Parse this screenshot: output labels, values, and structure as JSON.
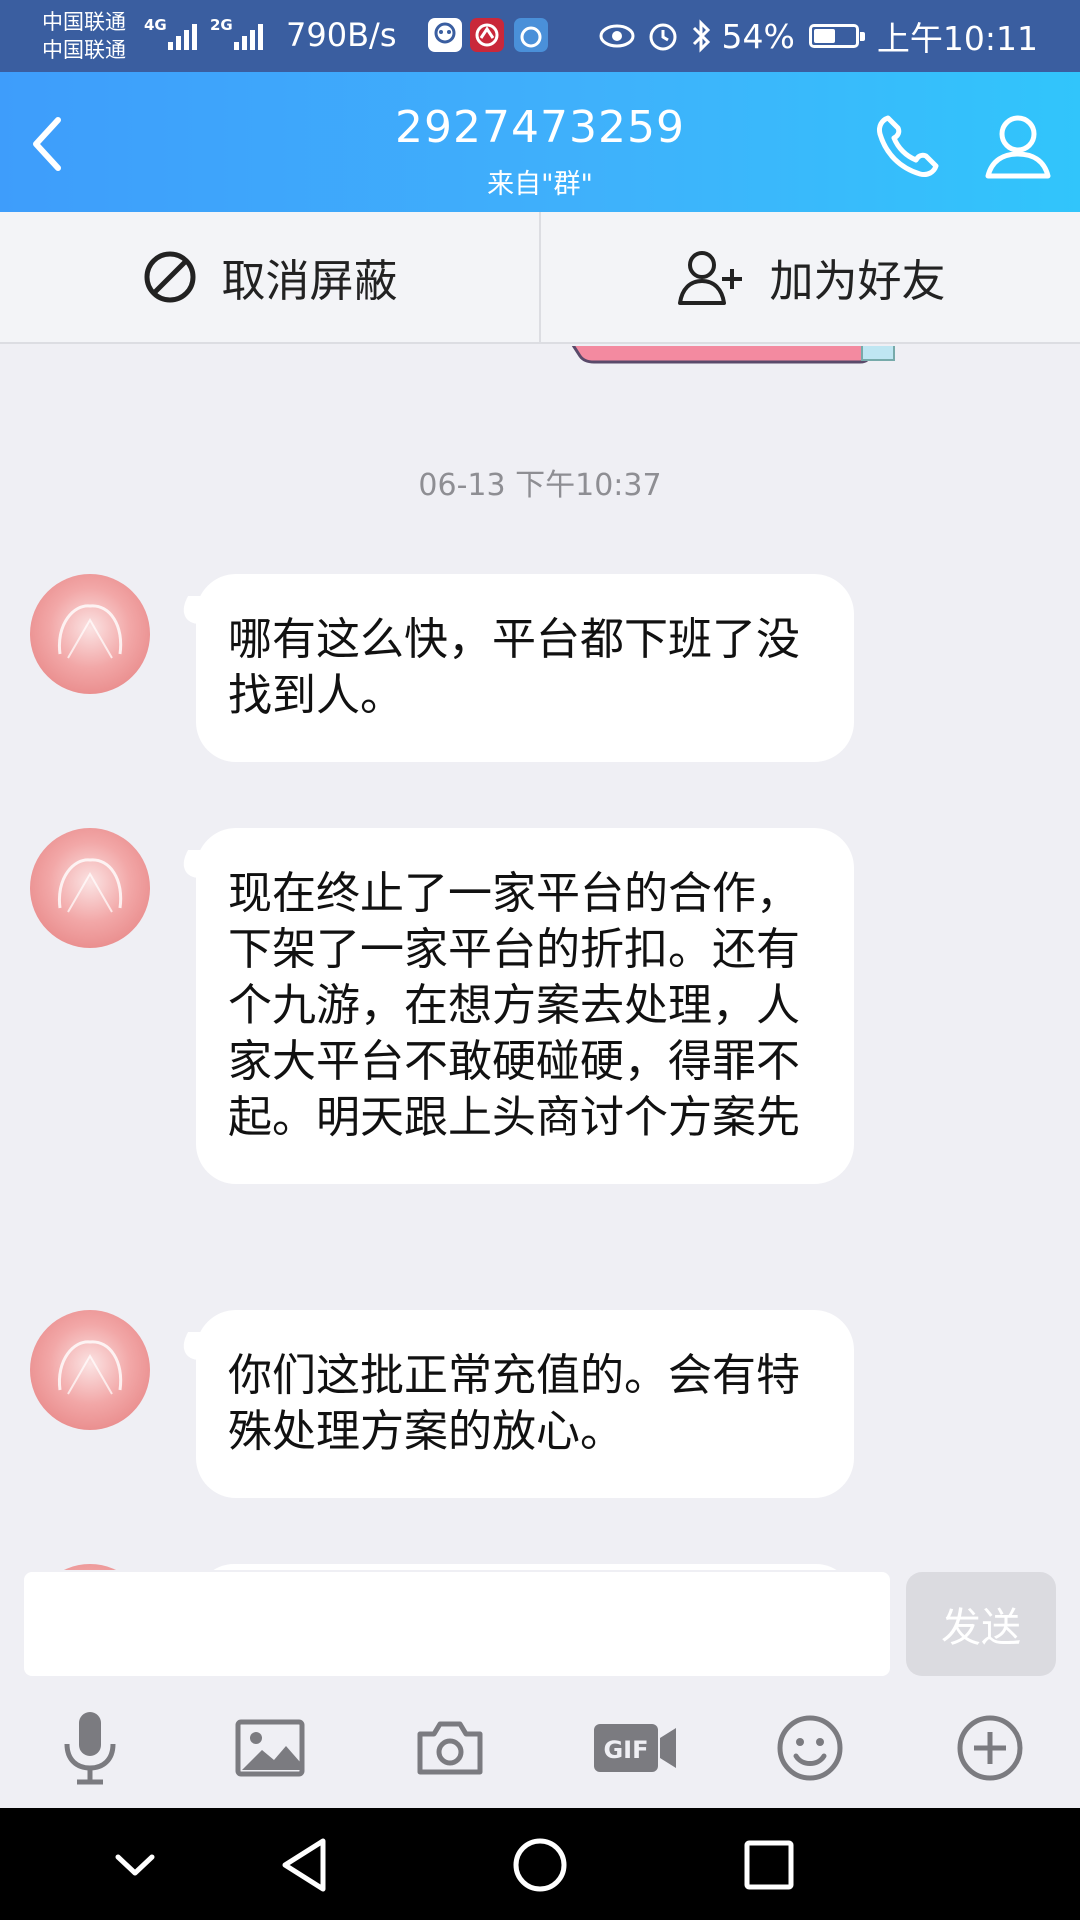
{
  "status_bar": {
    "carrier_1": "中国联通",
    "carrier_2": "中国联通",
    "network_1": "4G",
    "network_2": "2G",
    "speed": "790B/s",
    "battery": "54%",
    "time": "上午10:11",
    "icons": [
      "signal-icon",
      "app-notification-icon",
      "eye-icon",
      "alarm-icon",
      "bluetooth-icon",
      "battery-icon"
    ]
  },
  "header": {
    "title": "2927473259",
    "subtitle": "来自\"群\"",
    "accent": "#3ea6fb"
  },
  "actions": {
    "unblock_label": "取消屏蔽",
    "add_friend_label": "加为好友"
  },
  "chat": {
    "timestamp": "06-13 下午10:37",
    "messages": [
      {
        "text": "哪有这么快，平台都下班了没找到人。"
      },
      {
        "text": "现在终止了一家平台的合作，下架了一家平台的折扣。还有个九游，在想方案去处理，人家大平台不敢硬碰硬，得罪不起。明天跟上头商讨个方案先"
      },
      {
        "text": "你们这批正常充值的。会有特殊处理方案的放心。"
      }
    ]
  },
  "composer": {
    "input_value": "",
    "send_label": "发送"
  },
  "toolbar": {
    "items": [
      "microphone-icon",
      "image-icon",
      "camera-icon",
      "gif-icon",
      "emoji-icon",
      "plus-icon"
    ]
  },
  "nav": {
    "items": [
      "collapse-icon",
      "back-icon",
      "home-icon",
      "recents-icon"
    ]
  }
}
